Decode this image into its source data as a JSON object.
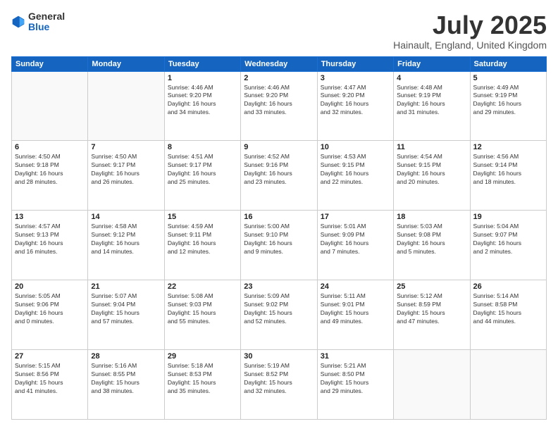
{
  "header": {
    "logo": {
      "general": "General",
      "blue": "Blue"
    },
    "title": "July 2025",
    "location": "Hainault, England, United Kingdom"
  },
  "calendar": {
    "headers": [
      "Sunday",
      "Monday",
      "Tuesday",
      "Wednesday",
      "Thursday",
      "Friday",
      "Saturday"
    ],
    "weeks": [
      [
        {
          "day": "",
          "info": ""
        },
        {
          "day": "",
          "info": ""
        },
        {
          "day": "1",
          "info": "Sunrise: 4:46 AM\nSunset: 9:20 PM\nDaylight: 16 hours\nand 34 minutes."
        },
        {
          "day": "2",
          "info": "Sunrise: 4:46 AM\nSunset: 9:20 PM\nDaylight: 16 hours\nand 33 minutes."
        },
        {
          "day": "3",
          "info": "Sunrise: 4:47 AM\nSunset: 9:20 PM\nDaylight: 16 hours\nand 32 minutes."
        },
        {
          "day": "4",
          "info": "Sunrise: 4:48 AM\nSunset: 9:19 PM\nDaylight: 16 hours\nand 31 minutes."
        },
        {
          "day": "5",
          "info": "Sunrise: 4:49 AM\nSunset: 9:19 PM\nDaylight: 16 hours\nand 29 minutes."
        }
      ],
      [
        {
          "day": "6",
          "info": "Sunrise: 4:50 AM\nSunset: 9:18 PM\nDaylight: 16 hours\nand 28 minutes."
        },
        {
          "day": "7",
          "info": "Sunrise: 4:50 AM\nSunset: 9:17 PM\nDaylight: 16 hours\nand 26 minutes."
        },
        {
          "day": "8",
          "info": "Sunrise: 4:51 AM\nSunset: 9:17 PM\nDaylight: 16 hours\nand 25 minutes."
        },
        {
          "day": "9",
          "info": "Sunrise: 4:52 AM\nSunset: 9:16 PM\nDaylight: 16 hours\nand 23 minutes."
        },
        {
          "day": "10",
          "info": "Sunrise: 4:53 AM\nSunset: 9:15 PM\nDaylight: 16 hours\nand 22 minutes."
        },
        {
          "day": "11",
          "info": "Sunrise: 4:54 AM\nSunset: 9:15 PM\nDaylight: 16 hours\nand 20 minutes."
        },
        {
          "day": "12",
          "info": "Sunrise: 4:56 AM\nSunset: 9:14 PM\nDaylight: 16 hours\nand 18 minutes."
        }
      ],
      [
        {
          "day": "13",
          "info": "Sunrise: 4:57 AM\nSunset: 9:13 PM\nDaylight: 16 hours\nand 16 minutes."
        },
        {
          "day": "14",
          "info": "Sunrise: 4:58 AM\nSunset: 9:12 PM\nDaylight: 16 hours\nand 14 minutes."
        },
        {
          "day": "15",
          "info": "Sunrise: 4:59 AM\nSunset: 9:11 PM\nDaylight: 16 hours\nand 12 minutes."
        },
        {
          "day": "16",
          "info": "Sunrise: 5:00 AM\nSunset: 9:10 PM\nDaylight: 16 hours\nand 9 minutes."
        },
        {
          "day": "17",
          "info": "Sunrise: 5:01 AM\nSunset: 9:09 PM\nDaylight: 16 hours\nand 7 minutes."
        },
        {
          "day": "18",
          "info": "Sunrise: 5:03 AM\nSunset: 9:08 PM\nDaylight: 16 hours\nand 5 minutes."
        },
        {
          "day": "19",
          "info": "Sunrise: 5:04 AM\nSunset: 9:07 PM\nDaylight: 16 hours\nand 2 minutes."
        }
      ],
      [
        {
          "day": "20",
          "info": "Sunrise: 5:05 AM\nSunset: 9:06 PM\nDaylight: 16 hours\nand 0 minutes."
        },
        {
          "day": "21",
          "info": "Sunrise: 5:07 AM\nSunset: 9:04 PM\nDaylight: 15 hours\nand 57 minutes."
        },
        {
          "day": "22",
          "info": "Sunrise: 5:08 AM\nSunset: 9:03 PM\nDaylight: 15 hours\nand 55 minutes."
        },
        {
          "day": "23",
          "info": "Sunrise: 5:09 AM\nSunset: 9:02 PM\nDaylight: 15 hours\nand 52 minutes."
        },
        {
          "day": "24",
          "info": "Sunrise: 5:11 AM\nSunset: 9:01 PM\nDaylight: 15 hours\nand 49 minutes."
        },
        {
          "day": "25",
          "info": "Sunrise: 5:12 AM\nSunset: 8:59 PM\nDaylight: 15 hours\nand 47 minutes."
        },
        {
          "day": "26",
          "info": "Sunrise: 5:14 AM\nSunset: 8:58 PM\nDaylight: 15 hours\nand 44 minutes."
        }
      ],
      [
        {
          "day": "27",
          "info": "Sunrise: 5:15 AM\nSunset: 8:56 PM\nDaylight: 15 hours\nand 41 minutes."
        },
        {
          "day": "28",
          "info": "Sunrise: 5:16 AM\nSunset: 8:55 PM\nDaylight: 15 hours\nand 38 minutes."
        },
        {
          "day": "29",
          "info": "Sunrise: 5:18 AM\nSunset: 8:53 PM\nDaylight: 15 hours\nand 35 minutes."
        },
        {
          "day": "30",
          "info": "Sunrise: 5:19 AM\nSunset: 8:52 PM\nDaylight: 15 hours\nand 32 minutes."
        },
        {
          "day": "31",
          "info": "Sunrise: 5:21 AM\nSunset: 8:50 PM\nDaylight: 15 hours\nand 29 minutes."
        },
        {
          "day": "",
          "info": ""
        },
        {
          "day": "",
          "info": ""
        }
      ]
    ]
  }
}
